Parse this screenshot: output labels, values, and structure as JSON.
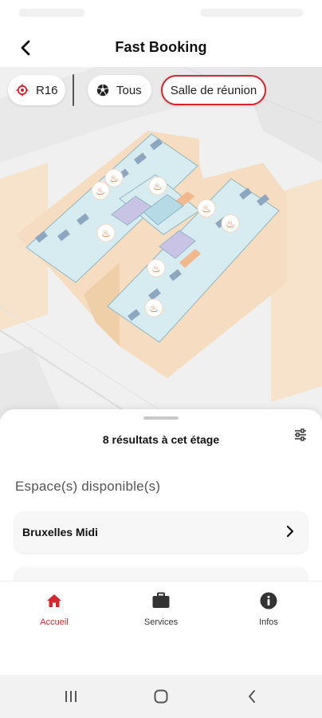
{
  "header": {
    "title": "Fast Booking"
  },
  "filters": {
    "floor_label": "R16",
    "all_label": "Tous",
    "room_type_label": "Salle de réunion"
  },
  "sheet": {
    "results_label": "8 résultats à cet étage",
    "section_title": "Espace(s) disponible(s)",
    "spaces": [
      {
        "name": "Bruxelles Midi"
      }
    ]
  },
  "tabs": [
    {
      "label": "Accueil",
      "icon": "home-icon",
      "active": true
    },
    {
      "label": "Services",
      "icon": "briefcase-icon",
      "active": false
    },
    {
      "label": "Infos",
      "icon": "info-icon",
      "active": false
    }
  ],
  "colors": {
    "accent": "#d3262f",
    "marker": "#e8621c",
    "map_floor": "#d7ecf1",
    "map_block": "#f6dcc0"
  }
}
